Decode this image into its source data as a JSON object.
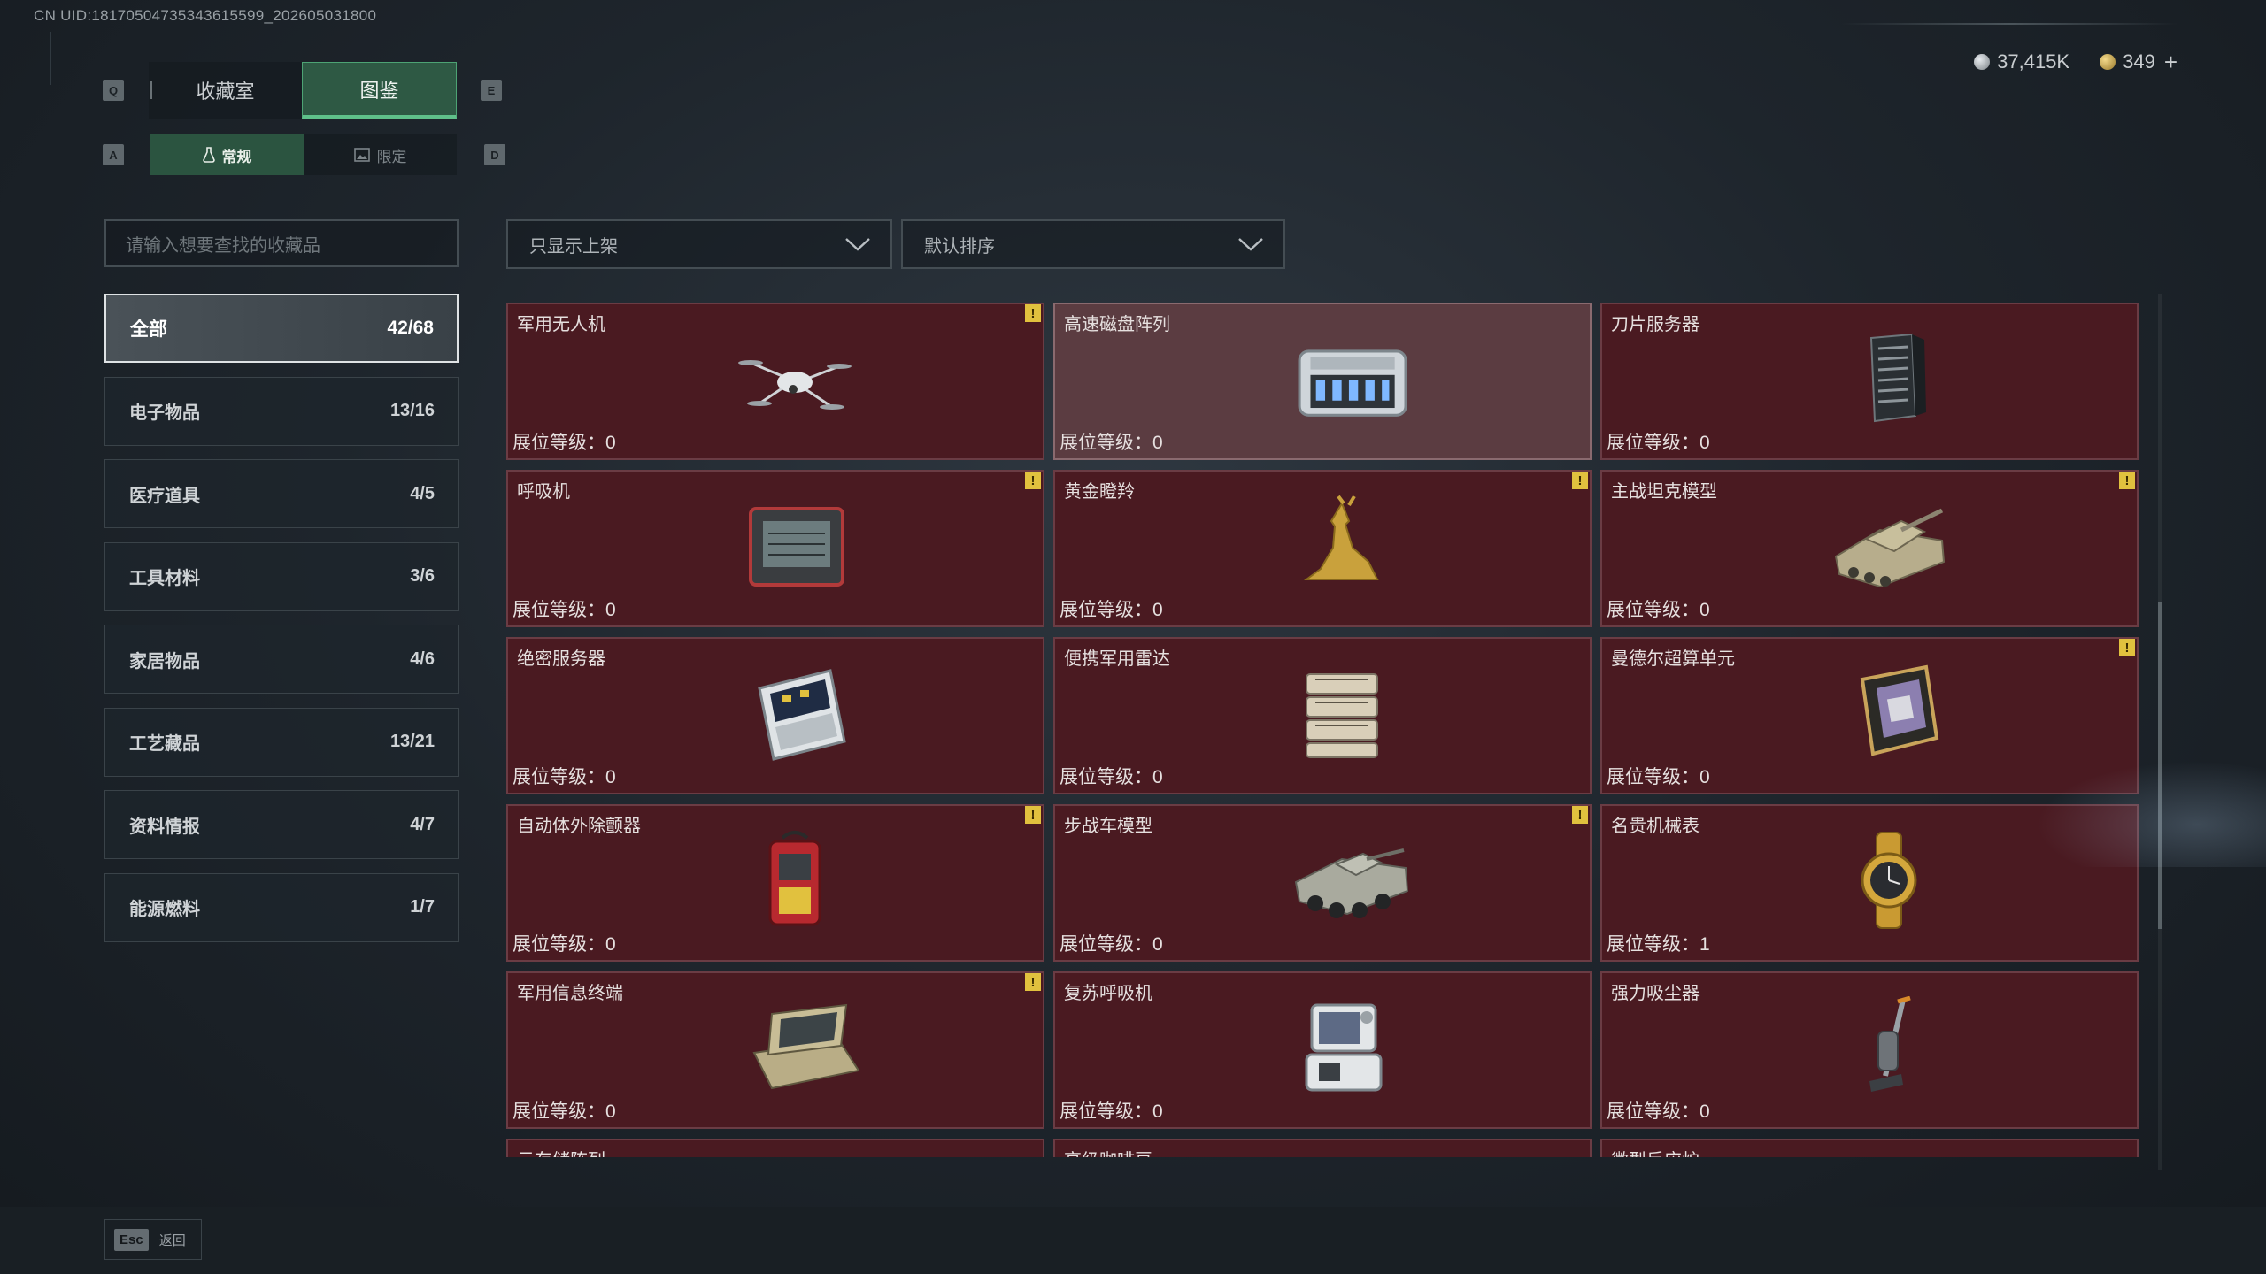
{
  "uid_text": "CN UID:18170504735343615599_202605031800",
  "keys": {
    "prev_tab": "Q",
    "next_tab": "E",
    "prev_subtab": "A",
    "next_subtab": "D",
    "back": "Esc"
  },
  "tabs": [
    {
      "label": "收藏室"
    },
    {
      "label": "图鉴"
    }
  ],
  "subtabs": [
    {
      "label": "常规"
    },
    {
      "label": "限定"
    }
  ],
  "currency": {
    "primary": "37,415K",
    "secondary": "349",
    "add": "+"
  },
  "search": {
    "placeholder": "请输入想要查找的收藏品"
  },
  "filters": {
    "shelf": "只显示上架",
    "sort": "默认排序"
  },
  "categories": [
    {
      "name": "全部",
      "count": "42/68"
    },
    {
      "name": "电子物品",
      "count": "13/16"
    },
    {
      "name": "医疗道具",
      "count": "4/5"
    },
    {
      "name": "工具材料",
      "count": "3/6"
    },
    {
      "name": "家居物品",
      "count": "4/6"
    },
    {
      "name": "工艺藏品",
      "count": "13/21"
    },
    {
      "name": "资料情报",
      "count": "4/7"
    },
    {
      "name": "能源燃料",
      "count": "1/7"
    }
  ],
  "items": [
    {
      "name": "军用无人机",
      "level": "展位等级：0",
      "warn": "!",
      "icon": "drone-icon"
    },
    {
      "name": "高速磁盘阵列",
      "level": "展位等级：0",
      "warn": "",
      "icon": "disk-array-icon"
    },
    {
      "name": "刀片服务器",
      "level": "展位等级：0",
      "warn": "",
      "icon": "blade-server-icon"
    },
    {
      "name": "呼吸机",
      "level": "展位等级：0",
      "warn": "!",
      "icon": "ventilator-icon"
    },
    {
      "name": "黄金瞪羚",
      "level": "展位等级：0",
      "warn": "!",
      "icon": "gold-gazelle-icon"
    },
    {
      "name": "主战坦克模型",
      "level": "展位等级：0",
      "warn": "!",
      "icon": "tank-model-icon"
    },
    {
      "name": "绝密服务器",
      "level": "展位等级：0",
      "warn": "",
      "icon": "secret-server-icon"
    },
    {
      "name": "便携军用雷达",
      "level": "展位等级：0",
      "warn": "",
      "icon": "radar-icon"
    },
    {
      "name": "曼德尔超算单元",
      "level": "展位等级：0",
      "warn": "!",
      "icon": "supercompute-unit-icon"
    },
    {
      "name": "自动体外除颤器",
      "level": "展位等级：0",
      "warn": "!",
      "icon": "defibrillator-icon"
    },
    {
      "name": "步战车模型",
      "level": "展位等级：0",
      "warn": "!",
      "icon": "ifv-model-icon"
    },
    {
      "name": "名贵机械表",
      "level": "展位等级：1",
      "warn": "",
      "icon": "watch-icon"
    },
    {
      "name": "军用信息终端",
      "level": "展位等级：0",
      "warn": "!",
      "icon": "info-terminal-icon"
    },
    {
      "name": "复苏呼吸机",
      "level": "展位等级：0",
      "warn": "",
      "icon": "resuscitator-icon"
    },
    {
      "name": "强力吸尘器",
      "level": "展位等级：0",
      "warn": "",
      "icon": "vacuum-icon"
    },
    {
      "name": "云存储阵列",
      "level": "",
      "warn": "",
      "icon": ""
    },
    {
      "name": "高级咖啡豆",
      "level": "",
      "warn": "",
      "icon": ""
    },
    {
      "name": "微型反应炉",
      "level": "",
      "warn": "",
      "icon": ""
    }
  ],
  "back_label": "返回",
  "colors": {
    "accent": "#5fc08a",
    "card_bg": "#4a1a21",
    "card_selected_bg": "#5b3c41",
    "warn": "#e1c13e"
  }
}
